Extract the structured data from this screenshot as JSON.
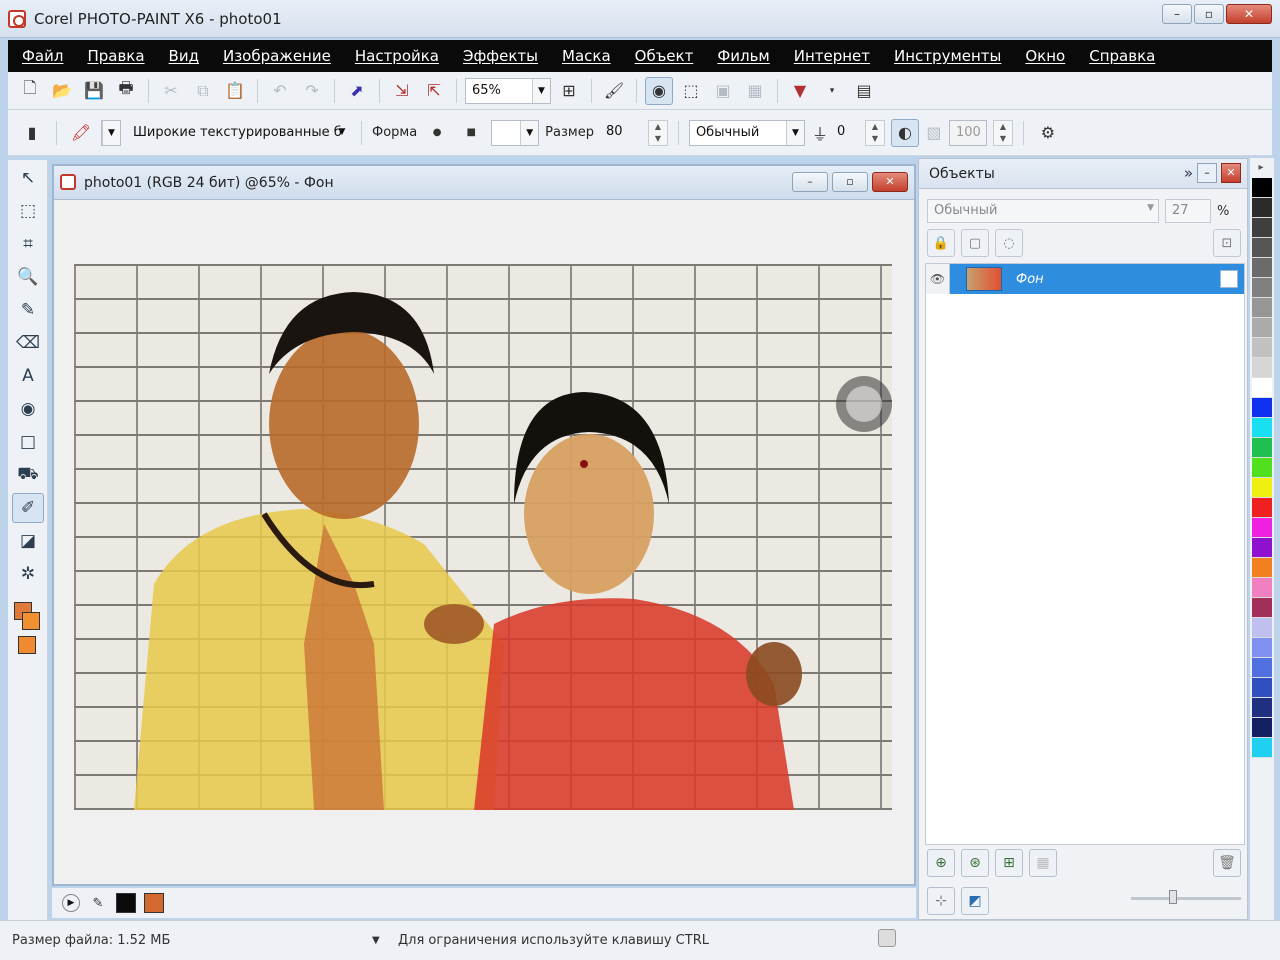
{
  "window": {
    "title": "Corel PHOTO-PAINT X6 - photo01",
    "minimize": "–",
    "maximize": "▫",
    "close": "✕"
  },
  "menu": [
    "Файл",
    "Правка",
    "Вид",
    "Изображение",
    "Настройка",
    "Эффекты",
    "Маска",
    "Объект",
    "Фильм",
    "Интернет",
    "Инструменты",
    "Окно",
    "Справка"
  ],
  "toolbar": {
    "zoom_value": "65%"
  },
  "property_bar": {
    "brush_type": "Широкие текстурированные б",
    "shape_label": "Форма",
    "size_label": "Размер",
    "size_value": "80",
    "merge_mode": "Обычный",
    "transparency_value": "0",
    "opacity_value": "100"
  },
  "document": {
    "title": "photo01 (RGB 24 бит) @65% - Фон"
  },
  "objects_docker": {
    "title": "Объекты",
    "expand_glyph": "»",
    "blend_mode": "Обычный",
    "opacity": "27",
    "percent": "%",
    "layers": [
      {
        "name": "Фон",
        "selected": true
      }
    ]
  },
  "doc_status": {
    "fg_color": "#0a0a0a",
    "bg_color": "#d2692e"
  },
  "palette": [
    "#000000",
    "#2b2b2b",
    "#3f3f3f",
    "#555555",
    "#6b6b6b",
    "#808080",
    "#969696",
    "#ababab",
    "#c1c1c1",
    "#d6d6d6",
    "#ffffff",
    "#1030f0",
    "#18e0f0",
    "#20c050",
    "#50e020",
    "#f0f010",
    "#f02020",
    "#f020e0",
    "#9010d0",
    "#f08020",
    "#f080c0",
    "#a0305a",
    "#c0c0f0",
    "#8090f0",
    "#5070e0",
    "#3050c0",
    "#203080",
    "#102060",
    "#20d0f0"
  ],
  "statusbar": {
    "file_size": "Размер файла: 1.52 МБ",
    "hint": "Для ограничения используйте клавишу CTRL"
  }
}
